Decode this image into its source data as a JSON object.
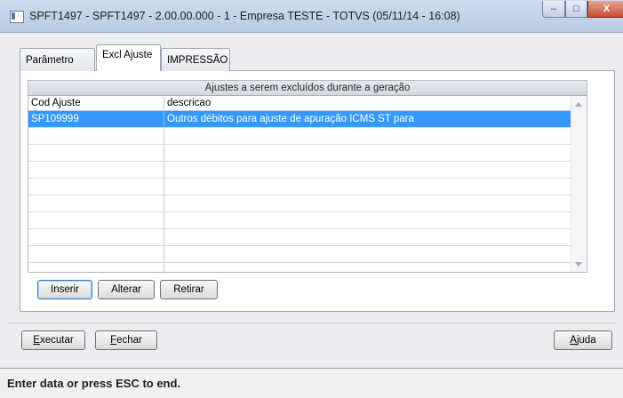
{
  "window": {
    "title": "SPFT1497 - SPFT1497 - 2.00.00.000 - 1 - Empresa TESTE - TOTVS (05/11/14 - 16:08)",
    "min_glyph": "–",
    "max_glyph": "□",
    "close_glyph": "X"
  },
  "tabs": [
    {
      "label": "Parâmetro",
      "active": false
    },
    {
      "label": "Excl Ajuste",
      "active": true
    },
    {
      "label": "IMPRESSÃO",
      "active": false
    }
  ],
  "grid": {
    "caption": "Ajustes a serem excluídos durante a geração",
    "columns": [
      "Cod Ajuste",
      "descricao"
    ],
    "rows": [
      [
        "SP109999",
        "Outros débitos para ajuste de apuração ICMS ST para"
      ],
      [
        "",
        ""
      ],
      [
        "",
        ""
      ],
      [
        "",
        ""
      ],
      [
        "",
        ""
      ],
      [
        "",
        ""
      ],
      [
        "",
        ""
      ],
      [
        "",
        ""
      ],
      [
        "",
        ""
      ],
      [
        "",
        ""
      ]
    ],
    "selected_row": 0
  },
  "grid_buttons": {
    "insert": "Inserir",
    "edit": "Alterar",
    "remove": "Retirar"
  },
  "footer_buttons": {
    "execute_first": "E",
    "execute_rest": "xecutar",
    "close_first": "F",
    "close_rest": "echar",
    "help_first": "A",
    "help_rest": "juda"
  },
  "status": {
    "text": "Enter data or press ESC to end."
  }
}
